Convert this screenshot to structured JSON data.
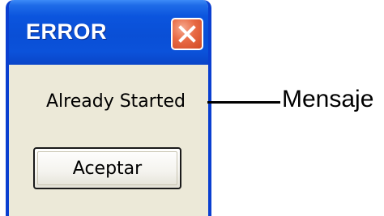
{
  "dialog": {
    "title": "ERROR",
    "message": "Already Started",
    "ok_label": "Aceptar",
    "close_icon": "close-icon"
  },
  "annotation": {
    "label": "Mensaje"
  },
  "colors": {
    "titlebar": "#0a4fd6",
    "close_button": "#e86a44",
    "dialog_body": "#ece9d8"
  }
}
